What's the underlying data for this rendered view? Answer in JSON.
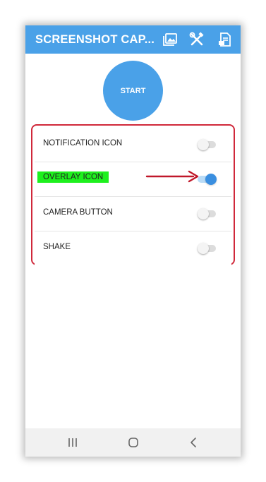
{
  "app": {
    "title": "SCREENSHOT CAP...",
    "accent_color": "#4aa1e8"
  },
  "toolbar": {
    "icons": [
      "gallery-icon",
      "tools-icon",
      "document-icon"
    ]
  },
  "start_button": {
    "label": "START"
  },
  "settings": {
    "items": [
      {
        "label": "NOTIFICATION ICON",
        "enabled": false
      },
      {
        "label": "OVERLAY ICON",
        "enabled": true
      },
      {
        "label": "CAMERA BUTTON",
        "enabled": false
      },
      {
        "label": "SHAKE",
        "enabled": false
      }
    ]
  },
  "annotation": {
    "highlight_color": "#1ef01e",
    "frame_color": "#d0283a",
    "arrow_color": "#c0182a"
  },
  "navbar": {
    "icons": [
      "recent-apps-icon",
      "home-icon",
      "back-icon"
    ]
  }
}
